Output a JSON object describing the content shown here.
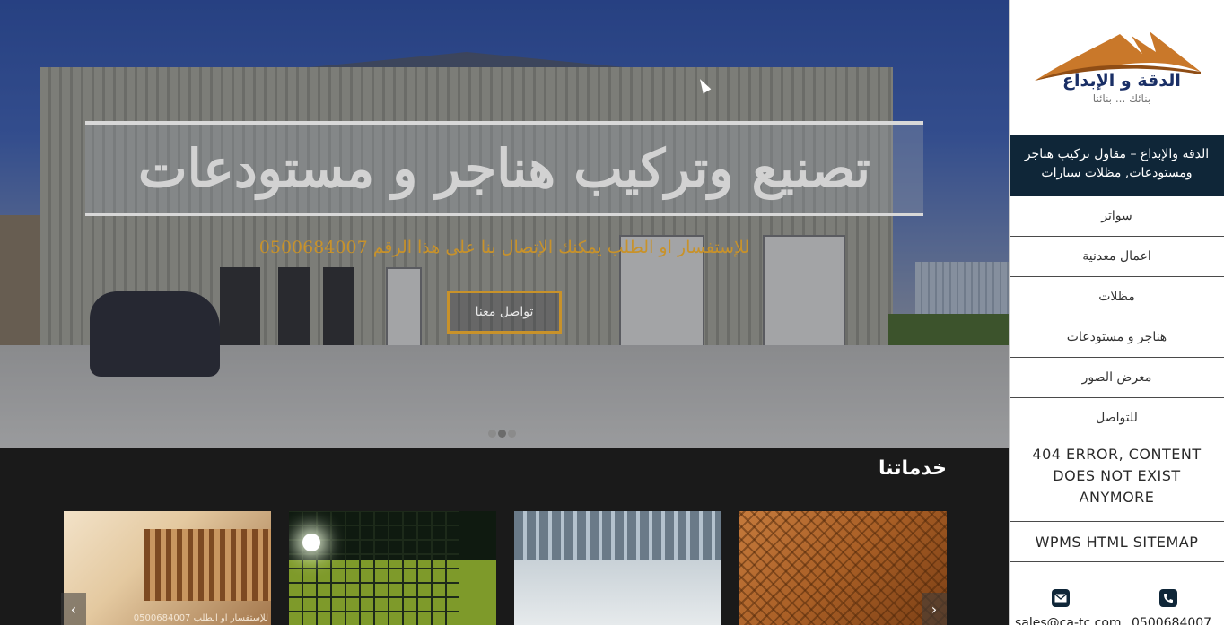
{
  "hero": {
    "title": "تصنيع وتركيب هناجر و مستودعات",
    "subtitle": "للإستفسار او الطلب يمكنك الإتصال بنا على هذا الرقم 0500684007",
    "cta_label": "تواصل معنا",
    "slides_count": 3,
    "active_slide": 1
  },
  "services": {
    "title": "خدماتنا",
    "items": [
      {
        "caption": "للإستفسار او الطلب 0500684007",
        "icon": "wooden-pergola-image"
      },
      {
        "caption": "",
        "icon": "fence-night-image"
      },
      {
        "caption": "",
        "icon": "warehouse-interior-image"
      },
      {
        "caption": "",
        "icon": "arched-shade-image"
      }
    ],
    "prev_arrow": "‹",
    "next_arrow": "›"
  },
  "sidebar": {
    "logo": {
      "name": "الدقة و الإبداع",
      "slogan": "بنائك ... بنائنا"
    },
    "site_description": "الدقة والإبداع – مقاول تركيب هناجر ومستودعات, مظلات سيارات",
    "nav": [
      {
        "label": "سواتر"
      },
      {
        "label": "اعمال معدنية"
      },
      {
        "label": "مظلات"
      },
      {
        "label": "هناجر و مستودعات"
      },
      {
        "label": "معرض الصور"
      },
      {
        "label": "للتواصل"
      }
    ],
    "widget_404": "404 ERROR, CONTENT DOES NOT EXIST ANYMORE",
    "widget_sitemap": "WPMS HTML SITEMAP",
    "contact": {
      "email": "sales@ca-tc.com",
      "phone": "0500684007"
    }
  },
  "colors": {
    "accent": "#c8922a",
    "sidebar_dark": "#0f2638",
    "page_dark": "#1a1a1a"
  }
}
